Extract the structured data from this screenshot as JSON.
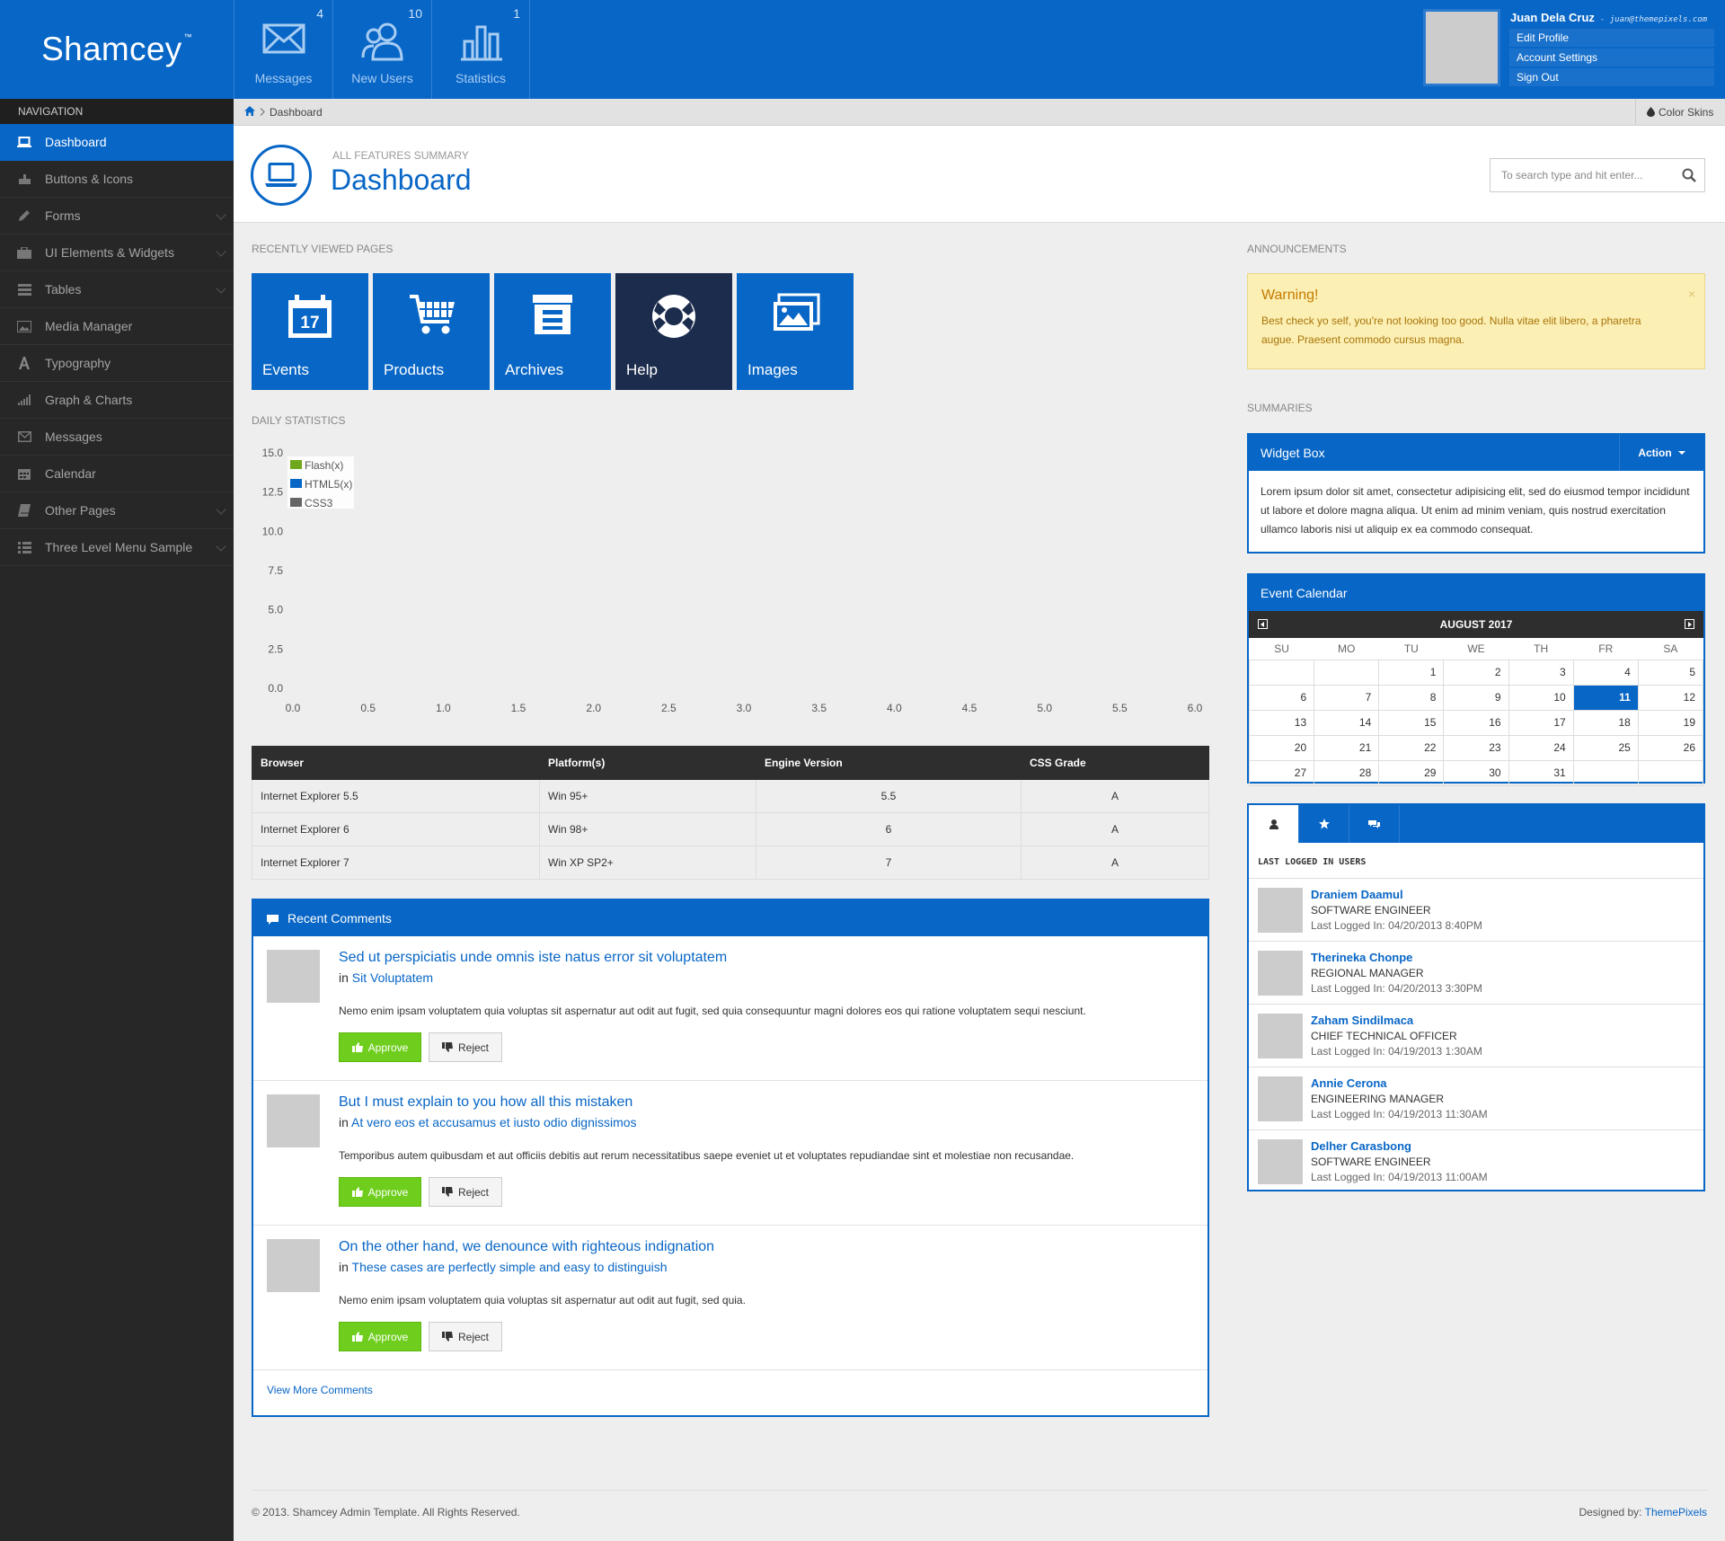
{
  "brand": {
    "name": "Shamcey",
    "mark": "™"
  },
  "header": {
    "stats": [
      {
        "label": "Messages",
        "count": "4",
        "icon": "envelope-icon"
      },
      {
        "label": "New Users",
        "count": "10",
        "icon": "users-icon"
      },
      {
        "label": "Statistics",
        "count": "1",
        "icon": "bar-chart-icon"
      }
    ],
    "user": {
      "name": "Juan Dela Cruz",
      "email": "- juan@themepixels.com",
      "menu": [
        "Edit Profile",
        "Account Settings",
        "Sign Out"
      ]
    }
  },
  "sidebar": {
    "title": "Navigation",
    "items": [
      {
        "label": "Dashboard",
        "icon": "laptop-icon"
      },
      {
        "label": "Buttons & Icons",
        "icon": "hand-icon"
      },
      {
        "label": "Forms",
        "icon": "pencil-icon"
      },
      {
        "label": "UI Elements & Widgets",
        "icon": "briefcase-icon"
      },
      {
        "label": "Tables",
        "icon": "list-icon"
      },
      {
        "label": "Media Manager",
        "icon": "picture-icon"
      },
      {
        "label": "Typography",
        "icon": "font-icon"
      },
      {
        "label": "Graph & Charts",
        "icon": "signal-icon"
      },
      {
        "label": "Messages",
        "icon": "envelope-icon"
      },
      {
        "label": "Calendar",
        "icon": "calendar-icon"
      },
      {
        "label": "Other Pages",
        "icon": "book-icon"
      },
      {
        "label": "Three Level Menu Sample",
        "icon": "th-list-icon"
      }
    ]
  },
  "breadcrumb": {
    "current": "Dashboard",
    "right": "Color Skins"
  },
  "page": {
    "subtitle": "All Features Summary",
    "title": "Dashboard"
  },
  "search": {
    "placeholder": "To search type and hit enter..."
  },
  "recent": {
    "title": "Recently Viewed Pages",
    "tiles": [
      "Events",
      "Products",
      "Archives",
      "Help",
      "Images"
    ],
    "calendar_day": "17"
  },
  "daily": {
    "title": "Daily Statistics"
  },
  "chart_data": {
    "type": "line",
    "title": "",
    "xlabel": "",
    "ylabel": "",
    "xlim": [
      0,
      6
    ],
    "ylim": [
      0,
      15
    ],
    "x_ticks": [
      "0.0",
      "0.5",
      "1.0",
      "1.5",
      "2.0",
      "2.5",
      "3.0",
      "3.5",
      "4.0",
      "4.5",
      "5.0",
      "5.5",
      "6.0"
    ],
    "y_ticks": [
      "0.0",
      "2.5",
      "5.0",
      "7.5",
      "10.0",
      "12.5",
      "15.0"
    ],
    "series": [
      {
        "name": "Flash(x)",
        "color": "#6fa81c",
        "values": []
      },
      {
        "name": "HTML5(x)",
        "color": "#0866c6",
        "values": []
      },
      {
        "name": "CSS3",
        "color": "#666666",
        "values": []
      }
    ],
    "legend": "top-left",
    "grid": false
  },
  "browser_table": {
    "headers": [
      "Browser",
      "Platform(s)",
      "Engine Version",
      "CSS Grade"
    ],
    "rows": [
      [
        "Internet Explorer 5.5",
        "Win 95+",
        "5.5",
        "A"
      ],
      [
        "Internet Explorer 6",
        "Win 98+",
        "6",
        "A"
      ],
      [
        "Internet Explorer 7",
        "Win XP SP2+",
        "7",
        "A"
      ]
    ]
  },
  "comments": {
    "title": "Recent Comments",
    "items": [
      {
        "title": "Sed ut perspiciatis unde omnis iste natus error sit voluptatem",
        "in": "Sit Voluptatem",
        "body": "Nemo enim ipsam voluptatem quia voluptas sit aspernatur aut odit aut fugit, sed quia consequuntur magni dolores eos qui ratione voluptatem sequi nesciunt."
      },
      {
        "title": "But I must explain to you how all this mistaken",
        "in": "At vero eos et accusamus et iusto odio dignissimos",
        "body": "Temporibus autem quibusdam et aut officiis debitis aut rerum necessitatibus saepe eveniet ut et voluptates repudiandae sint et molestiae non recusandae."
      },
      {
        "title": "On the other hand, we denounce with righteous indignation",
        "in": "These cases are perfectly simple and easy to distinguish",
        "body": "Nemo enim ipsam voluptatem quia voluptas sit aspernatur aut odit aut fugit, sed quia."
      }
    ],
    "in_prefix": "in",
    "approve": "Approve",
    "reject": "Reject",
    "view_more": "View More Comments"
  },
  "announcements": {
    "title": "Announcements",
    "warning_title": "Warning!",
    "warning_body": "Best check yo self, you're not looking too good. Nulla vitae elit libero, a pharetra augue. Praesent commodo cursus magna.",
    "close": "×"
  },
  "summaries": {
    "title": "Summaries",
    "widget_title": "Widget Box",
    "action": "Action",
    "widget_body": "Lorem ipsum dolor sit amet, consectetur adipisicing elit, sed do eiusmod tempor incididunt ut labore et dolore magna aliqua. Ut enim ad minim veniam, quis nostrud exercitation ullamco laboris nisi ut aliquip ex ea commodo consequat."
  },
  "calendar": {
    "title": "Event Calendar",
    "month": "AUGUST 2017",
    "days": [
      "SU",
      "MO",
      "TU",
      "WE",
      "TH",
      "FR",
      "SA"
    ],
    "weeks": [
      [
        "",
        "",
        "1",
        "2",
        "3",
        "4",
        "5"
      ],
      [
        "6",
        "7",
        "8",
        "9",
        "10",
        "11",
        "12"
      ],
      [
        "13",
        "14",
        "15",
        "16",
        "17",
        "18",
        "19"
      ],
      [
        "20",
        "21",
        "22",
        "23",
        "24",
        "25",
        "26"
      ],
      [
        "27",
        "28",
        "29",
        "30",
        "31",
        "",
        ""
      ]
    ],
    "today": "11"
  },
  "users_widget": {
    "label": "Last Logged In Users",
    "tabs": [
      "user-icon",
      "star-icon",
      "comments-icon"
    ],
    "users": [
      {
        "name": "Draniem Daamul",
        "role": "Software Engineer",
        "last": "Last Logged In: 04/20/2013 8:40PM"
      },
      {
        "name": "Therineka Chonpe",
        "role": "Regional Manager",
        "last": "Last Logged In: 04/20/2013 3:30PM"
      },
      {
        "name": "Zaham Sindilmaca",
        "role": "Chief Technical Officer",
        "last": "Last Logged In: 04/19/2013 1:30AM"
      },
      {
        "name": "Annie Cerona",
        "role": "Engineering Manager",
        "last": "Last Logged In: 04/19/2013 11:30AM"
      },
      {
        "name": "Delher Carasbong",
        "role": "Software Engineer",
        "last": "Last Logged In: 04/19/2013 11:00AM"
      }
    ]
  },
  "footer": {
    "copyright": "© 2013. Shamcey Admin Template. All Rights Reserved.",
    "designed_by": "Designed by:",
    "designer": "ThemePixels"
  },
  "colors": {
    "primary": "#0866c6",
    "dark": "#272727",
    "approve": "#6fce1d",
    "warning_bg": "#fcefb3"
  }
}
